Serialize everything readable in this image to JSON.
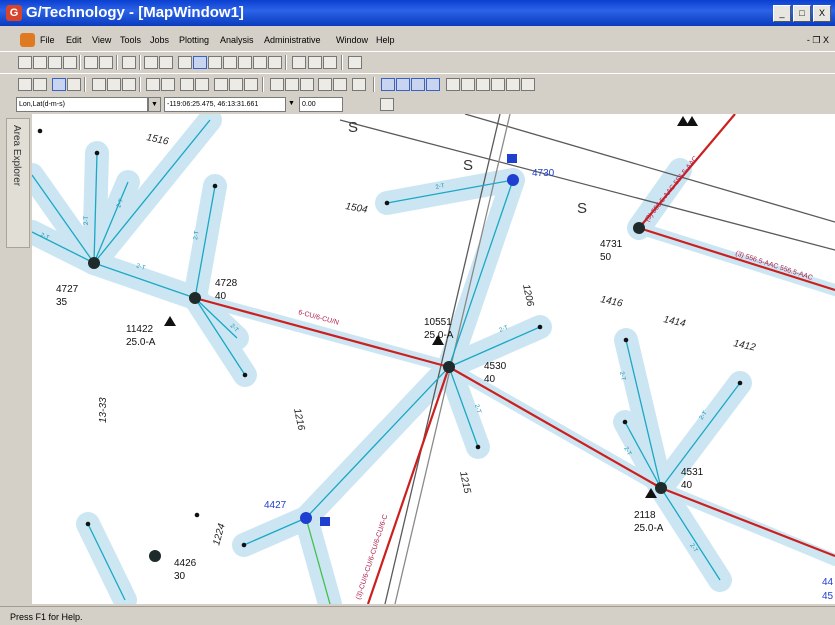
{
  "window": {
    "title": "G/Technology - [MapWindow1]",
    "app_icon": "G",
    "controls": [
      "_",
      "□",
      "X"
    ]
  },
  "menu": {
    "items": [
      "File",
      "Edit",
      "View",
      "Tools",
      "Jobs",
      "Plotting",
      "Analysis",
      "Administrative",
      "Window",
      "Help"
    ],
    "mdi_controls": "- ❐ X"
  },
  "coordbar": {
    "coord_system": "Lon,Lat(d-m-s)",
    "position": "-119:06:25.475, 46:13:31.661",
    "value": "0.00"
  },
  "explorer": {
    "label": "Area Explorer"
  },
  "status": {
    "text": "Press F1 for Help."
  },
  "map": {
    "features": {
      "f4727": {
        "id": "4727",
        "sub": "35"
      },
      "f4728": {
        "id": "4728",
        "sub": "40"
      },
      "f4530": {
        "id": "4530",
        "sub": "40"
      },
      "f4531": {
        "id": "4531",
        "sub": "40"
      },
      "f4731": {
        "id": "4731",
        "sub": "50"
      },
      "f4426": {
        "id": "4426",
        "sub": "30"
      },
      "f4730": {
        "id": "4730"
      },
      "f4427": {
        "id": "4427"
      },
      "f4433": {
        "id": "44",
        "sub": "45"
      }
    },
    "transformers": {
      "t11422": {
        "id": "11422",
        "rating": "25.0-A"
      },
      "t10551": {
        "id": "10551",
        "rating": "25.0-A"
      },
      "t2118": {
        "id": "2118",
        "rating": "25.0-A"
      }
    },
    "addresses": {
      "a1516": "1516",
      "a1504": "1504",
      "a1206": "1206",
      "a1416": "1416",
      "a1414": "1414",
      "a1412": "1412",
      "a1333": "13-33",
      "a1216": "1216",
      "a1215": "1215",
      "a1224": "1224"
    },
    "sewer_labels": [
      "S",
      "S",
      "S"
    ],
    "conductor_labels": {
      "red_mid": "6-CU/6-CU/N",
      "red_tr1": "(3) 556.5-AAC 556.5-AAC",
      "red_tr2": "(3) 556.5-AAC 556.5-AAC",
      "red_vert": "(3)-CU/6-CU/6-CU/6-CU/6-C"
    },
    "service_labels": {
      "s1": "2-T",
      "s2": "2-T",
      "s3": "2-T",
      "s4": "2-T",
      "s5": "2-T",
      "s6": "2-T",
      "s7": "2-T",
      "s8": "2-T",
      "s9": "2-T",
      "s10": "2-T",
      "s11": "2-T",
      "s12": "2-T",
      "s13": "2-T"
    },
    "colors": {
      "primary_line": "#cc1f1f",
      "service_line": "#1aa8c4",
      "service_halo": "#a9d7ea",
      "sewer_line": "#5a5a5a",
      "highlight_label": "#1f3fd0",
      "pole": "#1f2a2a"
    }
  }
}
